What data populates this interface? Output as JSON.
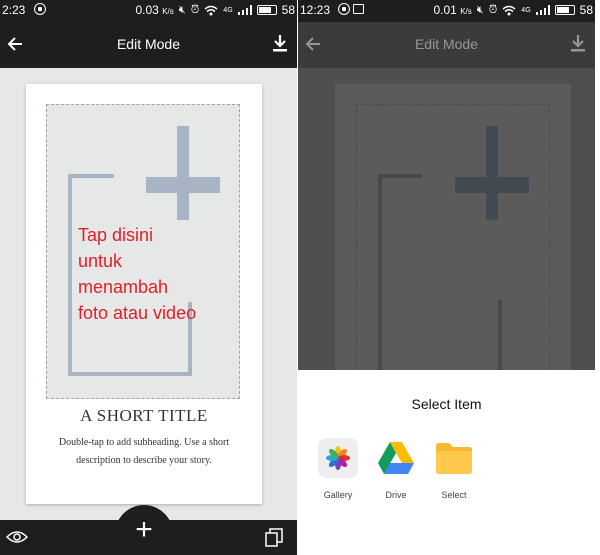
{
  "left_screen": {
    "status_bar": {
      "time": "2:23",
      "speed": "0.03",
      "speed_unit": "K/s",
      "signal": "4G",
      "battery": "58"
    },
    "app_bar": {
      "title": "Edit Mode"
    },
    "card": {
      "hint": "Tap disini untuk menambah foto atau video",
      "title": "A SHORT TITLE",
      "description": "Double-tap to add subheading. Use a short description to describe your story."
    },
    "accent_color": "#e0202a"
  },
  "right_screen": {
    "status_bar": {
      "time": "12:23",
      "speed": "0.01",
      "speed_unit": "K/s",
      "signal": "4G",
      "battery": "58"
    },
    "app_bar": {
      "title": "Edit Mode"
    },
    "sheet": {
      "title": "Select Item",
      "options": [
        {
          "label": "Gallery",
          "icon": "gallery-icon"
        },
        {
          "label": "Drive",
          "icon": "drive-icon"
        },
        {
          "label": "Select",
          "icon": "folder-icon"
        }
      ]
    }
  }
}
